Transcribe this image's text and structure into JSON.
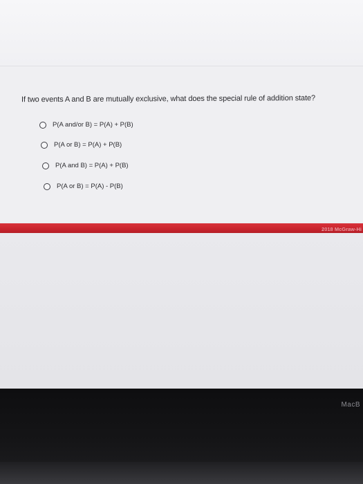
{
  "question": {
    "text": "If two events A and B are mutually exclusive, what does the special rule of addition state?"
  },
  "options": [
    {
      "label": "P(A and/or B) = P(A) + P(B)",
      "selected": false
    },
    {
      "label": "P(A or B) = P(A) + P(B)",
      "selected": false
    },
    {
      "label": "P(A and B) = P(A) + P(B)",
      "selected": false
    },
    {
      "label": "P(A or B) = P(A) - P(B)",
      "selected": false
    }
  ],
  "footer": {
    "copyright": "2018 McGraw-Hi",
    "bar_color": "#c8232d"
  },
  "device": {
    "brand": "MacB"
  }
}
